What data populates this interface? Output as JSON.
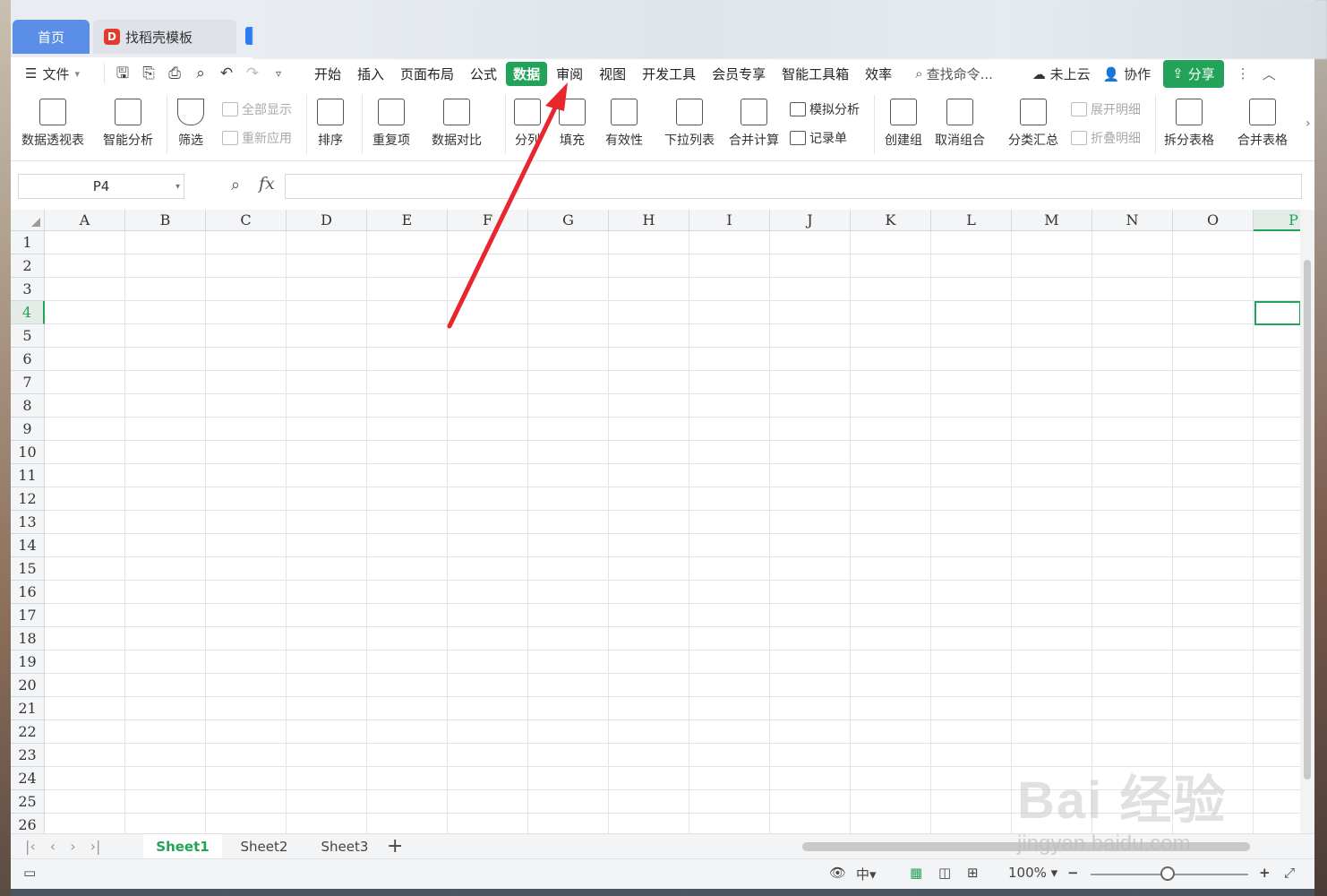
{
  "tabs": {
    "home": "首页",
    "doc": "找稻壳模板"
  },
  "menu": {
    "file": "文件",
    "tabs": [
      "开始",
      "插入",
      "页面布局",
      "公式",
      "数据",
      "审阅",
      "视图",
      "开发工具",
      "会员专享",
      "智能工具箱",
      "效率"
    ],
    "active_tab": "数据",
    "search": "查找命令...",
    "cloud": "未上云",
    "collab": "协作",
    "share": "分享"
  },
  "ribbon": {
    "pivot": "数据透视表",
    "smart_analysis": "智能分析",
    "filter": "筛选",
    "show_all": "全部显示",
    "reapply": "重新应用",
    "sort": "排序",
    "duplicates": "重复项",
    "compare": "数据对比",
    "split": "分列",
    "fill": "填充",
    "validity": "有效性",
    "dropdown": "下拉列表",
    "consolidate": "合并计算",
    "what_if": "模拟分析",
    "record_form": "记录单",
    "group": "创建组",
    "ungroup": "取消组合",
    "subtotal": "分类汇总",
    "expand_detail": "展开明细",
    "collapse_detail": "折叠明细",
    "split_table": "拆分表格",
    "merge_table": "合并表格"
  },
  "formula_bar": {
    "name_box": "P4",
    "fx": "fx",
    "value": ""
  },
  "grid": {
    "columns": [
      "A",
      "B",
      "C",
      "D",
      "E",
      "F",
      "G",
      "H",
      "I",
      "J",
      "K",
      "L",
      "M",
      "N",
      "O",
      "P"
    ],
    "rows": [
      "1",
      "2",
      "3",
      "4",
      "5",
      "6",
      "7",
      "8",
      "9",
      "10",
      "11",
      "12",
      "13",
      "14",
      "15",
      "16",
      "17",
      "18",
      "19",
      "20",
      "21",
      "22",
      "23",
      "24",
      "25",
      "26"
    ],
    "selected_cell": "P4"
  },
  "sheets": [
    "Sheet1",
    "Sheet2",
    "Sheet3"
  ],
  "active_sheet": "Sheet1",
  "status": {
    "zoom": "100%"
  },
  "watermark": {
    "brand": "Bai 经验",
    "url": "jingyan.baidu.com"
  },
  "colors": {
    "accent": "#23a35a",
    "home_tab": "#5b8ee6",
    "arrow": "#e8262d"
  }
}
